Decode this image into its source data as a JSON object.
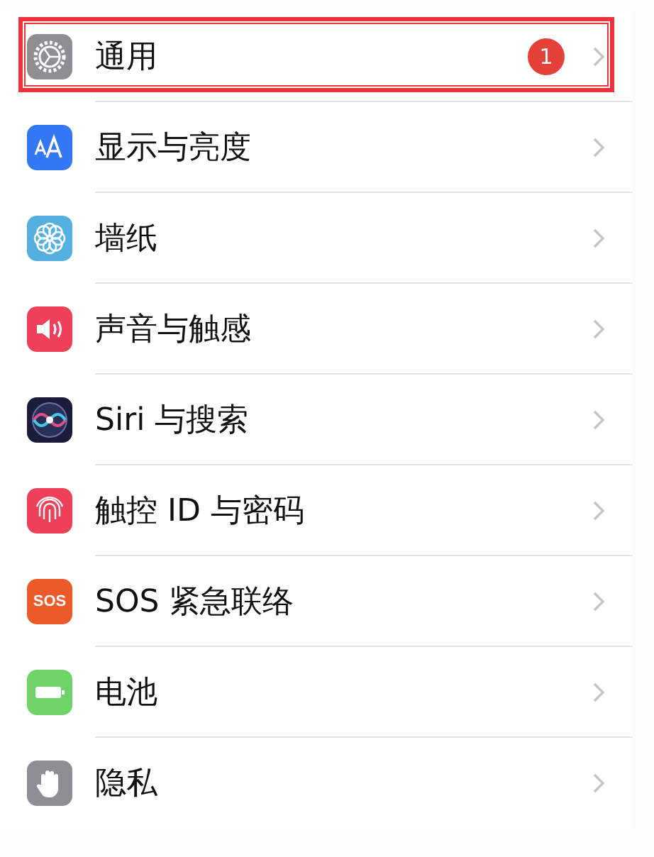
{
  "settings": [
    {
      "label": "通用",
      "kind": "gear",
      "color": "#8e8e93",
      "badge": "1",
      "highlighted": true
    },
    {
      "label": "显示与亮度",
      "kind": "text-size",
      "color": "#3478f6",
      "highlighted": false
    },
    {
      "label": "墙纸",
      "kind": "flower",
      "color": "#55b0e0",
      "highlighted": false
    },
    {
      "label": "声音与触感",
      "kind": "speaker",
      "color": "#ee4058",
      "highlighted": false
    },
    {
      "label": "Siri 与搜索",
      "kind": "siri",
      "color": "#1c1c3a",
      "highlighted": false
    },
    {
      "label": "触控 ID 与密码",
      "kind": "fingerprint",
      "color": "#ee4058",
      "highlighted": false
    },
    {
      "label": "SOS 紧急联络",
      "kind": "sos",
      "icon_text": "SOS",
      "color": "#ec5a2a",
      "highlighted": false
    },
    {
      "label": "电池",
      "kind": "battery",
      "color": "#6fd36a",
      "highlighted": false
    },
    {
      "label": "隐私",
      "kind": "hand",
      "color": "#8e8e93",
      "highlighted": false
    }
  ]
}
